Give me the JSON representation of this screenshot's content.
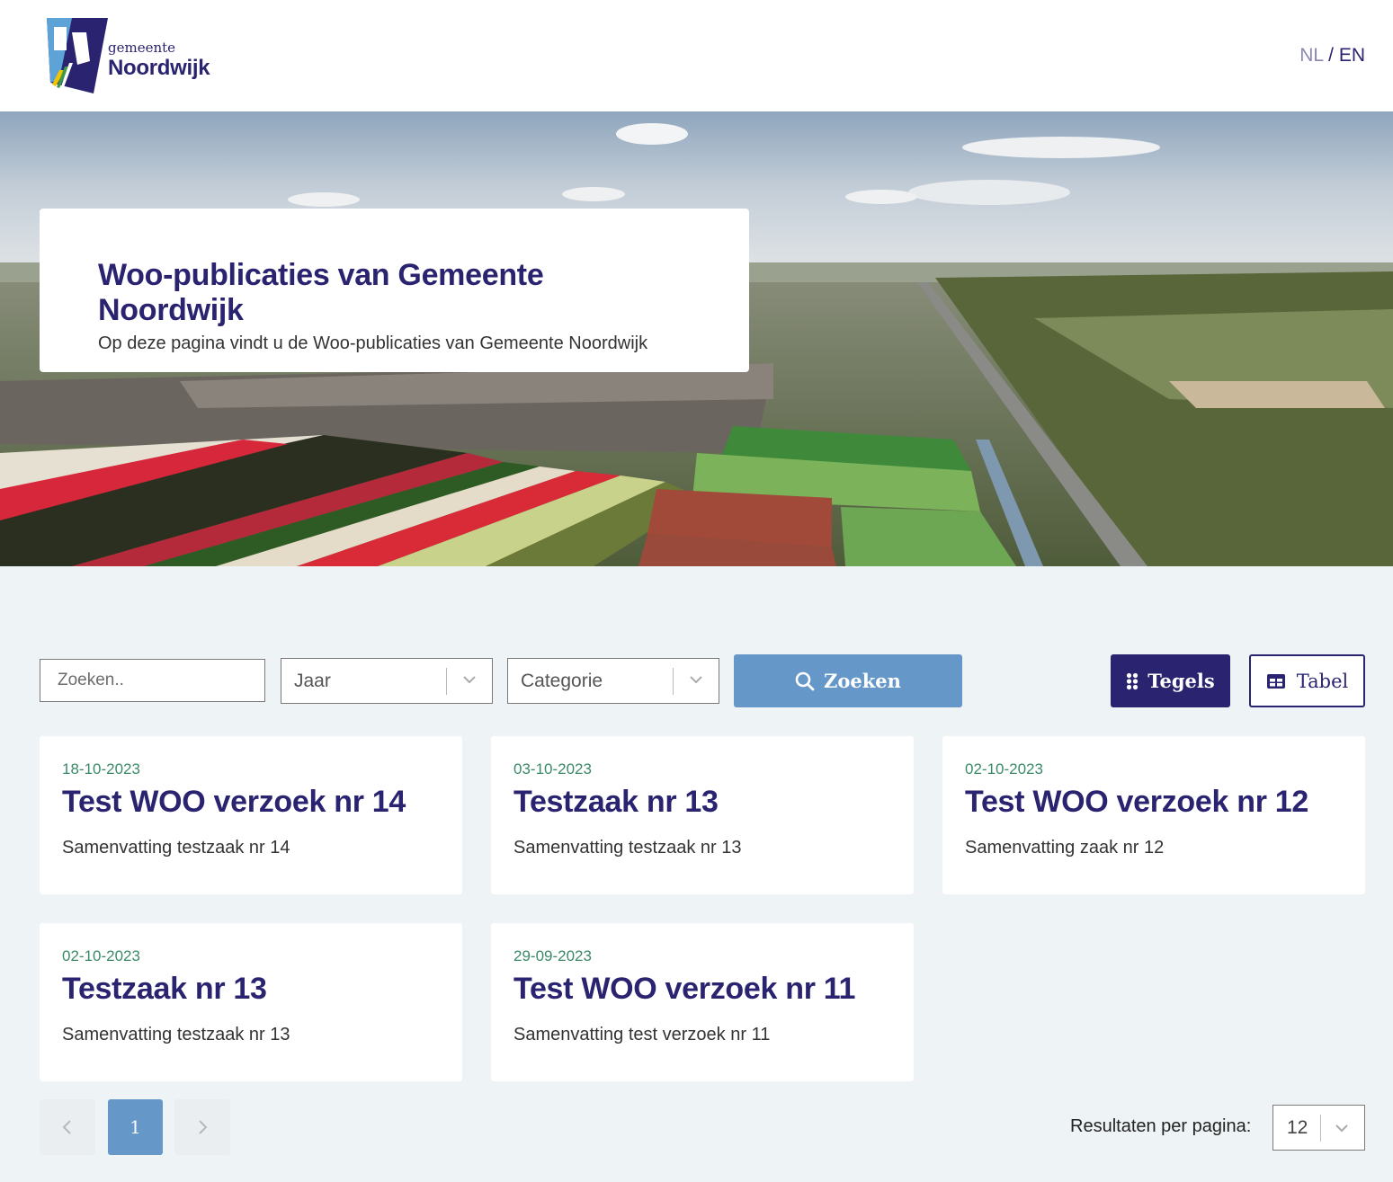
{
  "header": {
    "logo_small": "gemeente",
    "logo_big": "Noordwijk",
    "lang_nl": "NL",
    "lang_sep": " / ",
    "lang_en": "EN"
  },
  "hero": {
    "title": "Woo-publicaties van Gemeente Noordwijk",
    "subtitle": "Op deze pagina vindt u de Woo-publicaties van Gemeente Noordwijk"
  },
  "filters": {
    "search_placeholder": "Zoeken..",
    "year_label": "Jaar",
    "category_label": "Categorie",
    "search_button": "Zoeken",
    "tiles_button": "Tegels",
    "table_button": "Tabel"
  },
  "results": [
    {
      "date": "18-10-2023",
      "title": "Test WOO verzoek nr 14",
      "summary": "Samenvatting testzaak nr 14"
    },
    {
      "date": "03-10-2023",
      "title": "Testzaak nr 13",
      "summary": "Samenvatting testzaak nr 13"
    },
    {
      "date": "02-10-2023",
      "title": "Test WOO verzoek nr 12",
      "summary": "Samenvatting zaak nr 12"
    },
    {
      "date": "02-10-2023",
      "title": "Testzaak nr 13",
      "summary": "Samenvatting testzaak nr 13"
    },
    {
      "date": "29-09-2023",
      "title": "Test WOO verzoek nr 11",
      "summary": "Samenvatting test verzoek nr 11"
    }
  ],
  "pagination": {
    "current_page": "1",
    "results_per_page_label": "Resultaten per pagina:",
    "results_per_page_value": "12"
  },
  "colors": {
    "brand": "#2a2370",
    "accent": "#6597c9",
    "date": "#3a8a68",
    "background": "#eef3f6"
  },
  "icons": [
    "search-icon",
    "grid-icon",
    "table-icon",
    "chevron-down-icon",
    "chevron-left-icon",
    "chevron-right-icon"
  ]
}
